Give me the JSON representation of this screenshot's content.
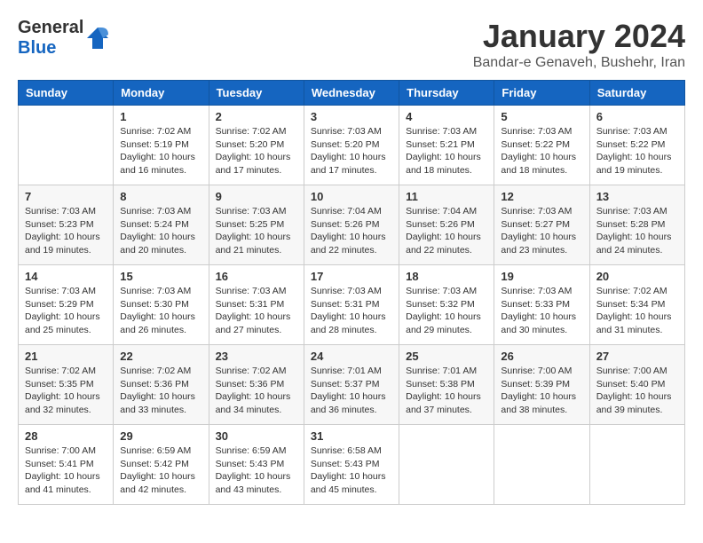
{
  "header": {
    "logo_general": "General",
    "logo_blue": "Blue",
    "month_year": "January 2024",
    "location": "Bandar-e Genaveh, Bushehr, Iran"
  },
  "calendar": {
    "weekdays": [
      "Sunday",
      "Monday",
      "Tuesday",
      "Wednesday",
      "Thursday",
      "Friday",
      "Saturday"
    ],
    "weeks": [
      [
        {
          "day": "",
          "sunrise": "",
          "sunset": "",
          "daylight": ""
        },
        {
          "day": "1",
          "sunrise": "Sunrise: 7:02 AM",
          "sunset": "Sunset: 5:19 PM",
          "daylight": "Daylight: 10 hours and 16 minutes."
        },
        {
          "day": "2",
          "sunrise": "Sunrise: 7:02 AM",
          "sunset": "Sunset: 5:20 PM",
          "daylight": "Daylight: 10 hours and 17 minutes."
        },
        {
          "day": "3",
          "sunrise": "Sunrise: 7:03 AM",
          "sunset": "Sunset: 5:20 PM",
          "daylight": "Daylight: 10 hours and 17 minutes."
        },
        {
          "day": "4",
          "sunrise": "Sunrise: 7:03 AM",
          "sunset": "Sunset: 5:21 PM",
          "daylight": "Daylight: 10 hours and 18 minutes."
        },
        {
          "day": "5",
          "sunrise": "Sunrise: 7:03 AM",
          "sunset": "Sunset: 5:22 PM",
          "daylight": "Daylight: 10 hours and 18 minutes."
        },
        {
          "day": "6",
          "sunrise": "Sunrise: 7:03 AM",
          "sunset": "Sunset: 5:22 PM",
          "daylight": "Daylight: 10 hours and 19 minutes."
        }
      ],
      [
        {
          "day": "7",
          "sunrise": "Sunrise: 7:03 AM",
          "sunset": "Sunset: 5:23 PM",
          "daylight": "Daylight: 10 hours and 19 minutes."
        },
        {
          "day": "8",
          "sunrise": "Sunrise: 7:03 AM",
          "sunset": "Sunset: 5:24 PM",
          "daylight": "Daylight: 10 hours and 20 minutes."
        },
        {
          "day": "9",
          "sunrise": "Sunrise: 7:03 AM",
          "sunset": "Sunset: 5:25 PM",
          "daylight": "Daylight: 10 hours and 21 minutes."
        },
        {
          "day": "10",
          "sunrise": "Sunrise: 7:04 AM",
          "sunset": "Sunset: 5:26 PM",
          "daylight": "Daylight: 10 hours and 22 minutes."
        },
        {
          "day": "11",
          "sunrise": "Sunrise: 7:04 AM",
          "sunset": "Sunset: 5:26 PM",
          "daylight": "Daylight: 10 hours and 22 minutes."
        },
        {
          "day": "12",
          "sunrise": "Sunrise: 7:03 AM",
          "sunset": "Sunset: 5:27 PM",
          "daylight": "Daylight: 10 hours and 23 minutes."
        },
        {
          "day": "13",
          "sunrise": "Sunrise: 7:03 AM",
          "sunset": "Sunset: 5:28 PM",
          "daylight": "Daylight: 10 hours and 24 minutes."
        }
      ],
      [
        {
          "day": "14",
          "sunrise": "Sunrise: 7:03 AM",
          "sunset": "Sunset: 5:29 PM",
          "daylight": "Daylight: 10 hours and 25 minutes."
        },
        {
          "day": "15",
          "sunrise": "Sunrise: 7:03 AM",
          "sunset": "Sunset: 5:30 PM",
          "daylight": "Daylight: 10 hours and 26 minutes."
        },
        {
          "day": "16",
          "sunrise": "Sunrise: 7:03 AM",
          "sunset": "Sunset: 5:31 PM",
          "daylight": "Daylight: 10 hours and 27 minutes."
        },
        {
          "day": "17",
          "sunrise": "Sunrise: 7:03 AM",
          "sunset": "Sunset: 5:31 PM",
          "daylight": "Daylight: 10 hours and 28 minutes."
        },
        {
          "day": "18",
          "sunrise": "Sunrise: 7:03 AM",
          "sunset": "Sunset: 5:32 PM",
          "daylight": "Daylight: 10 hours and 29 minutes."
        },
        {
          "day": "19",
          "sunrise": "Sunrise: 7:03 AM",
          "sunset": "Sunset: 5:33 PM",
          "daylight": "Daylight: 10 hours and 30 minutes."
        },
        {
          "day": "20",
          "sunrise": "Sunrise: 7:02 AM",
          "sunset": "Sunset: 5:34 PM",
          "daylight": "Daylight: 10 hours and 31 minutes."
        }
      ],
      [
        {
          "day": "21",
          "sunrise": "Sunrise: 7:02 AM",
          "sunset": "Sunset: 5:35 PM",
          "daylight": "Daylight: 10 hours and 32 minutes."
        },
        {
          "day": "22",
          "sunrise": "Sunrise: 7:02 AM",
          "sunset": "Sunset: 5:36 PM",
          "daylight": "Daylight: 10 hours and 33 minutes."
        },
        {
          "day": "23",
          "sunrise": "Sunrise: 7:02 AM",
          "sunset": "Sunset: 5:36 PM",
          "daylight": "Daylight: 10 hours and 34 minutes."
        },
        {
          "day": "24",
          "sunrise": "Sunrise: 7:01 AM",
          "sunset": "Sunset: 5:37 PM",
          "daylight": "Daylight: 10 hours and 36 minutes."
        },
        {
          "day": "25",
          "sunrise": "Sunrise: 7:01 AM",
          "sunset": "Sunset: 5:38 PM",
          "daylight": "Daylight: 10 hours and 37 minutes."
        },
        {
          "day": "26",
          "sunrise": "Sunrise: 7:00 AM",
          "sunset": "Sunset: 5:39 PM",
          "daylight": "Daylight: 10 hours and 38 minutes."
        },
        {
          "day": "27",
          "sunrise": "Sunrise: 7:00 AM",
          "sunset": "Sunset: 5:40 PM",
          "daylight": "Daylight: 10 hours and 39 minutes."
        }
      ],
      [
        {
          "day": "28",
          "sunrise": "Sunrise: 7:00 AM",
          "sunset": "Sunset: 5:41 PM",
          "daylight": "Daylight: 10 hours and 41 minutes."
        },
        {
          "day": "29",
          "sunrise": "Sunrise: 6:59 AM",
          "sunset": "Sunset: 5:42 PM",
          "daylight": "Daylight: 10 hours and 42 minutes."
        },
        {
          "day": "30",
          "sunrise": "Sunrise: 6:59 AM",
          "sunset": "Sunset: 5:43 PM",
          "daylight": "Daylight: 10 hours and 43 minutes."
        },
        {
          "day": "31",
          "sunrise": "Sunrise: 6:58 AM",
          "sunset": "Sunset: 5:43 PM",
          "daylight": "Daylight: 10 hours and 45 minutes."
        },
        {
          "day": "",
          "sunrise": "",
          "sunset": "",
          "daylight": ""
        },
        {
          "day": "",
          "sunrise": "",
          "sunset": "",
          "daylight": ""
        },
        {
          "day": "",
          "sunrise": "",
          "sunset": "",
          "daylight": ""
        }
      ]
    ]
  }
}
